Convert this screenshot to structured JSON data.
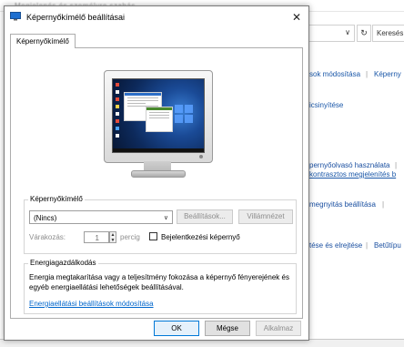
{
  "background_window": {
    "title_blurred": "Megjelenés és személyre szabás",
    "refresh_icon": "refresh-icon",
    "search_placeholder": "Keresés a",
    "links": [
      {
        "text": "sok módosítása",
        "id": "link-1"
      },
      {
        "text": "Képerny",
        "id": "link-2"
      },
      {
        "text": "icsinyítése",
        "id": "link-3"
      },
      {
        "text": "pernyőolvasó használata",
        "id": "link-4"
      },
      {
        "text": "kontrasztos megjelenítés b",
        "id": "link-5"
      },
      {
        "text": "megnyitás beállítása",
        "id": "link-6"
      },
      {
        "text": "tése és elrejtése",
        "id": "link-7"
      },
      {
        "text": "Betűtípu",
        "id": "link-8"
      }
    ],
    "separator": "|"
  },
  "dialog": {
    "title": "Képernyőkímélő beállításai",
    "close_label": "✕",
    "tab_label": "Képernyőkímélő",
    "screensaver_group": {
      "label": "Képernyőkímélő",
      "selected": "(Nincs)",
      "settings_button": "Beállítások...",
      "preview_button": "Villámnézet",
      "wait_label": "Várakozás:",
      "wait_value": "1",
      "wait_unit": "percig",
      "logon_checkbox_label": "Bejelentkezési képernyő",
      "logon_checked": false
    },
    "power_group": {
      "label": "Energiagazdálkodás",
      "description": "Energia megtakarítása vagy a teljesítmény fokozása a képernyő fényerejének és egyéb energiaellátási lehetőségek beállításával.",
      "link": "Energiaellátási beállítások módosítása"
    },
    "buttons": {
      "ok": "OK",
      "cancel": "Mégse",
      "apply": "Alkalmaz"
    }
  },
  "colors": {
    "link": "#0066cc",
    "primary_border": "#0078d7",
    "disabled_text": "#8d8d8d"
  }
}
